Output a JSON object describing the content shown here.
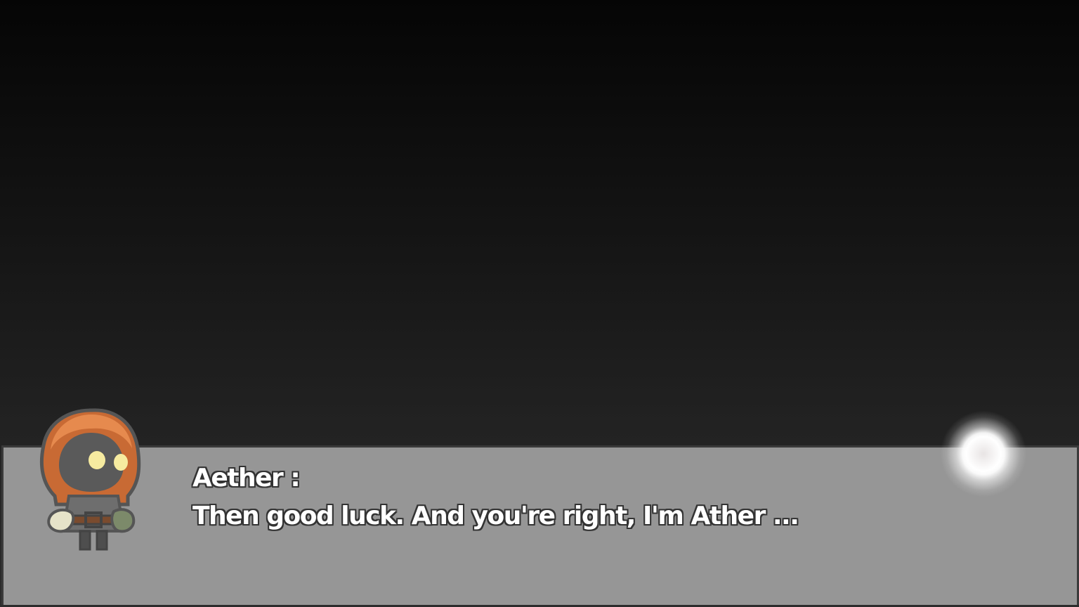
{
  "dialog": {
    "speaker": "Aether :",
    "text": "Then good luck. And you're right, I'm Ather ..."
  },
  "portrait": {
    "icon": "hooded-character-portrait",
    "hood_color": "#e07a3a",
    "eye_color": "#f6eba0"
  },
  "advance_indicator": {
    "icon": "glowing-orb-icon",
    "color": "#ffffff"
  },
  "colors": {
    "dialog_background": "#969696",
    "dialog_border": "#3a3a3a",
    "text": "#ffffff",
    "text_outline": "#333333"
  }
}
